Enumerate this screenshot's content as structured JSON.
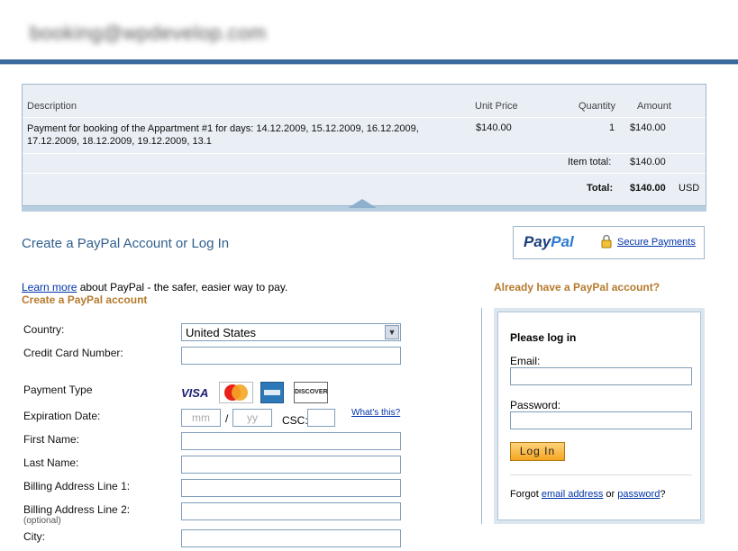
{
  "merchant": {
    "email": "booking@wpdevelop.com"
  },
  "cart": {
    "headers": {
      "description": "Description",
      "unit_price": "Unit Price",
      "quantity": "Quantity",
      "amount": "Amount"
    },
    "item": {
      "description": "Payment for booking of the Appartment #1 for days: 14.12.2009, 15.12.2009, 16.12.2009, 17.12.2009, 18.12.2009, 19.12.2009, 13.1",
      "unit_price": "$140.00",
      "quantity": "1",
      "amount": "$140.00"
    },
    "item_total_label": "Item total:",
    "item_total": "$140.00",
    "total_label": "Total:",
    "total": "$140.00",
    "currency": "USD"
  },
  "heading": "Create a PayPal Account or Log In",
  "badge": {
    "logo_a": "Pay",
    "logo_b": "Pal",
    "secure": "Secure Payments"
  },
  "learn": {
    "link": "Learn more",
    "text": " about PayPal - the safer, easier way to pay."
  },
  "create_label": "Create a PayPal account",
  "already_label": "Already have a PayPal account?",
  "form": {
    "country_label": "Country:",
    "country_value": "United States",
    "cc_label": "Credit Card Number:",
    "payment_type_label": "Payment Type",
    "cards": {
      "visa": "VISA",
      "discover": "DISCOVER"
    },
    "exp_label": "Expiration Date:",
    "mm": "mm",
    "yy": "yy",
    "slash": "/",
    "csc_label": "CSC:",
    "whats_this": "What's this?",
    "first_name": "First Name:",
    "last_name": "Last Name:",
    "addr1": "Billing Address Line 1:",
    "addr2": "Billing Address Line 2:",
    "optional": "(optional)",
    "city": "City:"
  },
  "login": {
    "title": "Please log in",
    "email_label": "Email:",
    "password_label": "Password:",
    "button": "Log In",
    "forgot_prefix": "Forgot ",
    "forgot_email": "email address",
    "or": " or ",
    "forgot_password": "password",
    "q": "?"
  },
  "colors": {
    "accent": "#30608e",
    "orange": "#b57a2c",
    "link": "#0033aa",
    "cart_bg": "#e9eff5"
  }
}
